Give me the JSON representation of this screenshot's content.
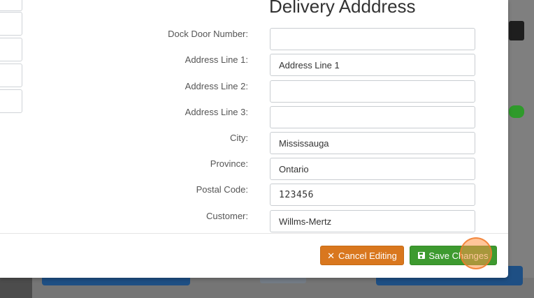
{
  "modal": {
    "section_title": "Delivery Adddress",
    "fields": [
      {
        "label": "Dock Door Number:",
        "value": ""
      },
      {
        "label": "Address Line 1:",
        "value": "Address Line 1"
      },
      {
        "label": "Address Line 2:",
        "value": ""
      },
      {
        "label": "Address Line 3:",
        "value": ""
      },
      {
        "label": "City:",
        "value": "Mississauga"
      },
      {
        "label": "Province:",
        "value": "Ontario"
      },
      {
        "label": "Postal Code:",
        "value": "123456"
      },
      {
        "label": "Customer:",
        "value": "Willms-Mertz"
      }
    ],
    "footer": {
      "cancel_label": "Cancel Editing",
      "cancel_icon": "times-icon",
      "save_label": "Save Changes",
      "save_icon": "floppy-disk-icon"
    }
  },
  "colors": {
    "cancel_button": "#d9771e",
    "save_button": "#3d9a2f",
    "background_primary_button": "#1e4f84",
    "click_indicator": "#f08a3c"
  }
}
